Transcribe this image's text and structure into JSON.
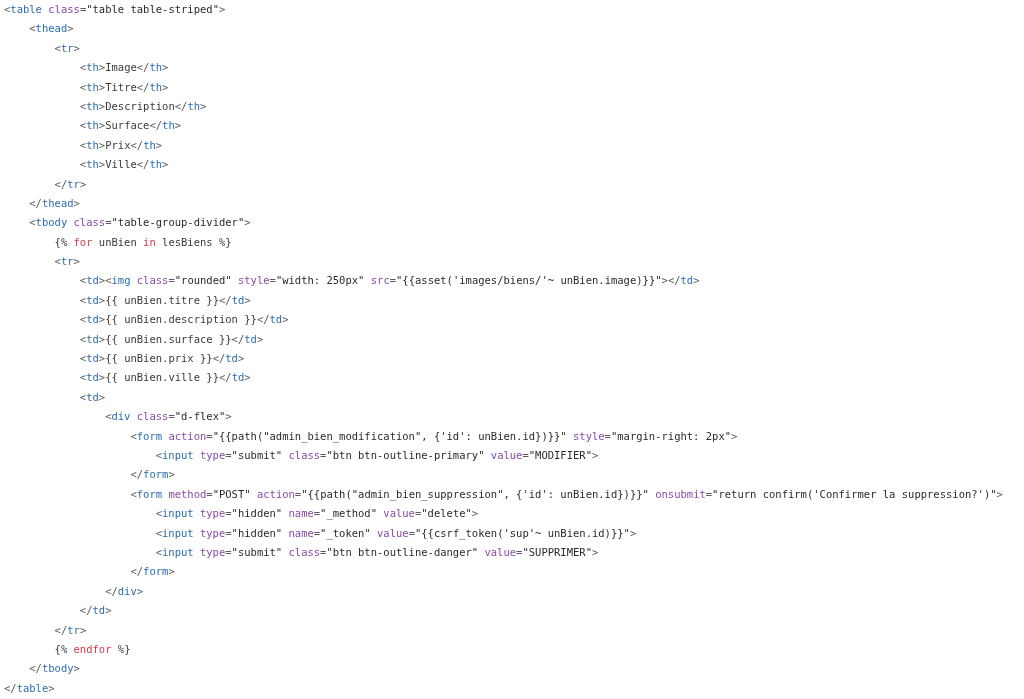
{
  "code_lines": [
    [
      {
        "kind": "p",
        "text": "<"
      },
      {
        "kind": "t",
        "text": "table"
      },
      {
        "kind": "a",
        "text": " class"
      },
      {
        "kind": "p",
        "text": "="
      },
      {
        "kind": "s",
        "text": "\"table table-striped\""
      },
      {
        "kind": "p",
        "text": ">"
      }
    ],
    [
      {
        "kind": "p",
        "text": "    <"
      },
      {
        "kind": "t",
        "text": "thead"
      },
      {
        "kind": "p",
        "text": ">"
      }
    ],
    [
      {
        "kind": "p",
        "text": "        <"
      },
      {
        "kind": "t",
        "text": "tr"
      },
      {
        "kind": "p",
        "text": ">"
      }
    ],
    [
      {
        "kind": "p",
        "text": "            <"
      },
      {
        "kind": "t",
        "text": "th"
      },
      {
        "kind": "p",
        "text": ">"
      },
      {
        "kind": "x",
        "text": "Image"
      },
      {
        "kind": "p",
        "text": "</"
      },
      {
        "kind": "t",
        "text": "th"
      },
      {
        "kind": "p",
        "text": ">"
      }
    ],
    [
      {
        "kind": "p",
        "text": "            <"
      },
      {
        "kind": "t",
        "text": "th"
      },
      {
        "kind": "p",
        "text": ">"
      },
      {
        "kind": "x",
        "text": "Titre"
      },
      {
        "kind": "p",
        "text": "</"
      },
      {
        "kind": "t",
        "text": "th"
      },
      {
        "kind": "p",
        "text": ">"
      }
    ],
    [
      {
        "kind": "p",
        "text": "            <"
      },
      {
        "kind": "t",
        "text": "th"
      },
      {
        "kind": "p",
        "text": ">"
      },
      {
        "kind": "x",
        "text": "Description"
      },
      {
        "kind": "p",
        "text": "</"
      },
      {
        "kind": "t",
        "text": "th"
      },
      {
        "kind": "p",
        "text": ">"
      }
    ],
    [
      {
        "kind": "p",
        "text": "            <"
      },
      {
        "kind": "t",
        "text": "th"
      },
      {
        "kind": "p",
        "text": ">"
      },
      {
        "kind": "x",
        "text": "Surface"
      },
      {
        "kind": "p",
        "text": "</"
      },
      {
        "kind": "t",
        "text": "th"
      },
      {
        "kind": "p",
        "text": ">"
      }
    ],
    [
      {
        "kind": "p",
        "text": "            <"
      },
      {
        "kind": "t",
        "text": "th"
      },
      {
        "kind": "p",
        "text": ">"
      },
      {
        "kind": "x",
        "text": "Prix"
      },
      {
        "kind": "p",
        "text": "</"
      },
      {
        "kind": "t",
        "text": "th"
      },
      {
        "kind": "p",
        "text": ">"
      }
    ],
    [
      {
        "kind": "p",
        "text": "            <"
      },
      {
        "kind": "t",
        "text": "th"
      },
      {
        "kind": "p",
        "text": ">"
      },
      {
        "kind": "x",
        "text": "Ville"
      },
      {
        "kind": "p",
        "text": "</"
      },
      {
        "kind": "t",
        "text": "th"
      },
      {
        "kind": "p",
        "text": ">"
      }
    ],
    [
      {
        "kind": "p",
        "text": "        </"
      },
      {
        "kind": "t",
        "text": "tr"
      },
      {
        "kind": "p",
        "text": ">"
      }
    ],
    [
      {
        "kind": "p",
        "text": "    </"
      },
      {
        "kind": "t",
        "text": "thead"
      },
      {
        "kind": "p",
        "text": ">"
      }
    ],
    [
      {
        "kind": "p",
        "text": "    <"
      },
      {
        "kind": "t",
        "text": "tbody"
      },
      {
        "kind": "a",
        "text": " class"
      },
      {
        "kind": "p",
        "text": "="
      },
      {
        "kind": "s",
        "text": "\"table-group-divider\""
      },
      {
        "kind": "p",
        "text": ">"
      }
    ],
    [
      {
        "kind": "x",
        "text": "        {% "
      },
      {
        "kind": "k",
        "text": "for"
      },
      {
        "kind": "x",
        "text": " unBien "
      },
      {
        "kind": "k",
        "text": "in"
      },
      {
        "kind": "x",
        "text": " lesBiens %}"
      }
    ],
    [
      {
        "kind": "p",
        "text": "        <"
      },
      {
        "kind": "t",
        "text": "tr"
      },
      {
        "kind": "p",
        "text": ">"
      }
    ],
    [
      {
        "kind": "p",
        "text": "            <"
      },
      {
        "kind": "t",
        "text": "td"
      },
      {
        "kind": "p",
        "text": "><"
      },
      {
        "kind": "t",
        "text": "img"
      },
      {
        "kind": "a",
        "text": " class"
      },
      {
        "kind": "p",
        "text": "="
      },
      {
        "kind": "s",
        "text": "\"rounded\""
      },
      {
        "kind": "a",
        "text": " style"
      },
      {
        "kind": "p",
        "text": "="
      },
      {
        "kind": "s",
        "text": "\"width: 250px\""
      },
      {
        "kind": "a",
        "text": " src"
      },
      {
        "kind": "p",
        "text": "="
      },
      {
        "kind": "s",
        "text": "\"{{asset('images/biens/'~ unBien.image)}}\""
      },
      {
        "kind": "p",
        "text": "></"
      },
      {
        "kind": "t",
        "text": "td"
      },
      {
        "kind": "p",
        "text": ">"
      }
    ],
    [
      {
        "kind": "p",
        "text": "            <"
      },
      {
        "kind": "t",
        "text": "td"
      },
      {
        "kind": "p",
        "text": ">"
      },
      {
        "kind": "x",
        "text": "{{ unBien.titre }}"
      },
      {
        "kind": "p",
        "text": "</"
      },
      {
        "kind": "t",
        "text": "td"
      },
      {
        "kind": "p",
        "text": ">"
      }
    ],
    [
      {
        "kind": "p",
        "text": "            <"
      },
      {
        "kind": "t",
        "text": "td"
      },
      {
        "kind": "p",
        "text": ">"
      },
      {
        "kind": "x",
        "text": "{{ unBien.description }}"
      },
      {
        "kind": "p",
        "text": "</"
      },
      {
        "kind": "t",
        "text": "td"
      },
      {
        "kind": "p",
        "text": ">"
      }
    ],
    [
      {
        "kind": "p",
        "text": "            <"
      },
      {
        "kind": "t",
        "text": "td"
      },
      {
        "kind": "p",
        "text": ">"
      },
      {
        "kind": "x",
        "text": "{{ unBien.surface }}"
      },
      {
        "kind": "p",
        "text": "</"
      },
      {
        "kind": "t",
        "text": "td"
      },
      {
        "kind": "p",
        "text": ">"
      }
    ],
    [
      {
        "kind": "p",
        "text": "            <"
      },
      {
        "kind": "t",
        "text": "td"
      },
      {
        "kind": "p",
        "text": ">"
      },
      {
        "kind": "x",
        "text": "{{ unBien.prix }}"
      },
      {
        "kind": "p",
        "text": "</"
      },
      {
        "kind": "t",
        "text": "td"
      },
      {
        "kind": "p",
        "text": ">"
      }
    ],
    [
      {
        "kind": "p",
        "text": "            <"
      },
      {
        "kind": "t",
        "text": "td"
      },
      {
        "kind": "p",
        "text": ">"
      },
      {
        "kind": "x",
        "text": "{{ unBien.ville }}"
      },
      {
        "kind": "p",
        "text": "</"
      },
      {
        "kind": "t",
        "text": "td"
      },
      {
        "kind": "p",
        "text": ">"
      }
    ],
    [
      {
        "kind": "p",
        "text": "            <"
      },
      {
        "kind": "t",
        "text": "td"
      },
      {
        "kind": "p",
        "text": ">"
      }
    ],
    [
      {
        "kind": "p",
        "text": "                <"
      },
      {
        "kind": "t",
        "text": "div"
      },
      {
        "kind": "a",
        "text": " class"
      },
      {
        "kind": "p",
        "text": "="
      },
      {
        "kind": "s",
        "text": "\"d-flex\""
      },
      {
        "kind": "p",
        "text": ">"
      }
    ],
    [
      {
        "kind": "p",
        "text": "                    <"
      },
      {
        "kind": "t",
        "text": "form"
      },
      {
        "kind": "a",
        "text": " action"
      },
      {
        "kind": "p",
        "text": "="
      },
      {
        "kind": "s",
        "text": "\"{{path(\"admin_bien_modification\", {'id': unBien.id})}}\""
      },
      {
        "kind": "a",
        "text": " style"
      },
      {
        "kind": "p",
        "text": "="
      },
      {
        "kind": "s",
        "text": "\"margin-right: 2px\""
      },
      {
        "kind": "p",
        "text": ">"
      }
    ],
    [
      {
        "kind": "p",
        "text": "                        <"
      },
      {
        "kind": "t",
        "text": "input"
      },
      {
        "kind": "a",
        "text": " type"
      },
      {
        "kind": "p",
        "text": "="
      },
      {
        "kind": "s",
        "text": "\"submit\""
      },
      {
        "kind": "a",
        "text": " class"
      },
      {
        "kind": "p",
        "text": "="
      },
      {
        "kind": "s",
        "text": "\"btn btn-outline-primary\""
      },
      {
        "kind": "a",
        "text": " value"
      },
      {
        "kind": "p",
        "text": "="
      },
      {
        "kind": "s",
        "text": "\"MODIFIER\""
      },
      {
        "kind": "p",
        "text": ">"
      }
    ],
    [
      {
        "kind": "p",
        "text": "                    </"
      },
      {
        "kind": "t",
        "text": "form"
      },
      {
        "kind": "p",
        "text": ">"
      }
    ],
    [
      {
        "kind": "p",
        "text": "                    <"
      },
      {
        "kind": "t",
        "text": "form"
      },
      {
        "kind": "a",
        "text": " method"
      },
      {
        "kind": "p",
        "text": "="
      },
      {
        "kind": "s",
        "text": "\"POST\""
      },
      {
        "kind": "a",
        "text": " action"
      },
      {
        "kind": "p",
        "text": "="
      },
      {
        "kind": "s",
        "text": "\"{{path(\"admin_bien_suppression\", {'id': unBien.id})}}\""
      },
      {
        "kind": "a",
        "text": " onsubmit"
      },
      {
        "kind": "p",
        "text": "="
      },
      {
        "kind": "s",
        "text": "\"return confirm('Confirmer la suppression?')\""
      },
      {
        "kind": "p",
        "text": ">"
      }
    ],
    [
      {
        "kind": "p",
        "text": "                        <"
      },
      {
        "kind": "t",
        "text": "input"
      },
      {
        "kind": "a",
        "text": " type"
      },
      {
        "kind": "p",
        "text": "="
      },
      {
        "kind": "s",
        "text": "\"hidden\""
      },
      {
        "kind": "a",
        "text": " name"
      },
      {
        "kind": "p",
        "text": "="
      },
      {
        "kind": "s",
        "text": "\"_method\""
      },
      {
        "kind": "a",
        "text": " value"
      },
      {
        "kind": "p",
        "text": "="
      },
      {
        "kind": "s",
        "text": "\"delete\""
      },
      {
        "kind": "p",
        "text": ">"
      }
    ],
    [
      {
        "kind": "p",
        "text": "                        <"
      },
      {
        "kind": "t",
        "text": "input"
      },
      {
        "kind": "a",
        "text": " type"
      },
      {
        "kind": "p",
        "text": "="
      },
      {
        "kind": "s",
        "text": "\"hidden\""
      },
      {
        "kind": "a",
        "text": " name"
      },
      {
        "kind": "p",
        "text": "="
      },
      {
        "kind": "s",
        "text": "\"_token\""
      },
      {
        "kind": "a",
        "text": " value"
      },
      {
        "kind": "p",
        "text": "="
      },
      {
        "kind": "s",
        "text": "\"{{csrf_token('sup'~ unBien.id)}}\""
      },
      {
        "kind": "p",
        "text": ">"
      }
    ],
    [
      {
        "kind": "p",
        "text": "                        <"
      },
      {
        "kind": "t",
        "text": "input"
      },
      {
        "kind": "a",
        "text": " type"
      },
      {
        "kind": "p",
        "text": "="
      },
      {
        "kind": "s",
        "text": "\"submit\""
      },
      {
        "kind": "a",
        "text": " class"
      },
      {
        "kind": "p",
        "text": "="
      },
      {
        "kind": "s",
        "text": "\"btn btn-outline-danger\""
      },
      {
        "kind": "a",
        "text": " value"
      },
      {
        "kind": "p",
        "text": "="
      },
      {
        "kind": "s",
        "text": "\"SUPPRIMER\""
      },
      {
        "kind": "p",
        "text": ">"
      }
    ],
    [
      {
        "kind": "p",
        "text": "                    </"
      },
      {
        "kind": "t",
        "text": "form"
      },
      {
        "kind": "p",
        "text": ">"
      }
    ],
    [
      {
        "kind": "p",
        "text": "                </"
      },
      {
        "kind": "t",
        "text": "div"
      },
      {
        "kind": "p",
        "text": ">"
      }
    ],
    [
      {
        "kind": "p",
        "text": "            </"
      },
      {
        "kind": "t",
        "text": "td"
      },
      {
        "kind": "p",
        "text": ">"
      }
    ],
    [
      {
        "kind": "p",
        "text": "        </"
      },
      {
        "kind": "t",
        "text": "tr"
      },
      {
        "kind": "p",
        "text": ">"
      }
    ],
    [
      {
        "kind": "x",
        "text": "        {% "
      },
      {
        "kind": "k",
        "text": "endfor"
      },
      {
        "kind": "x",
        "text": " %}"
      }
    ],
    [
      {
        "kind": "p",
        "text": "    </"
      },
      {
        "kind": "t",
        "text": "tbody"
      },
      {
        "kind": "p",
        "text": ">"
      }
    ],
    [
      {
        "kind": "p",
        "text": "</"
      },
      {
        "kind": "t",
        "text": "table"
      },
      {
        "kind": "p",
        "text": ">"
      }
    ]
  ]
}
